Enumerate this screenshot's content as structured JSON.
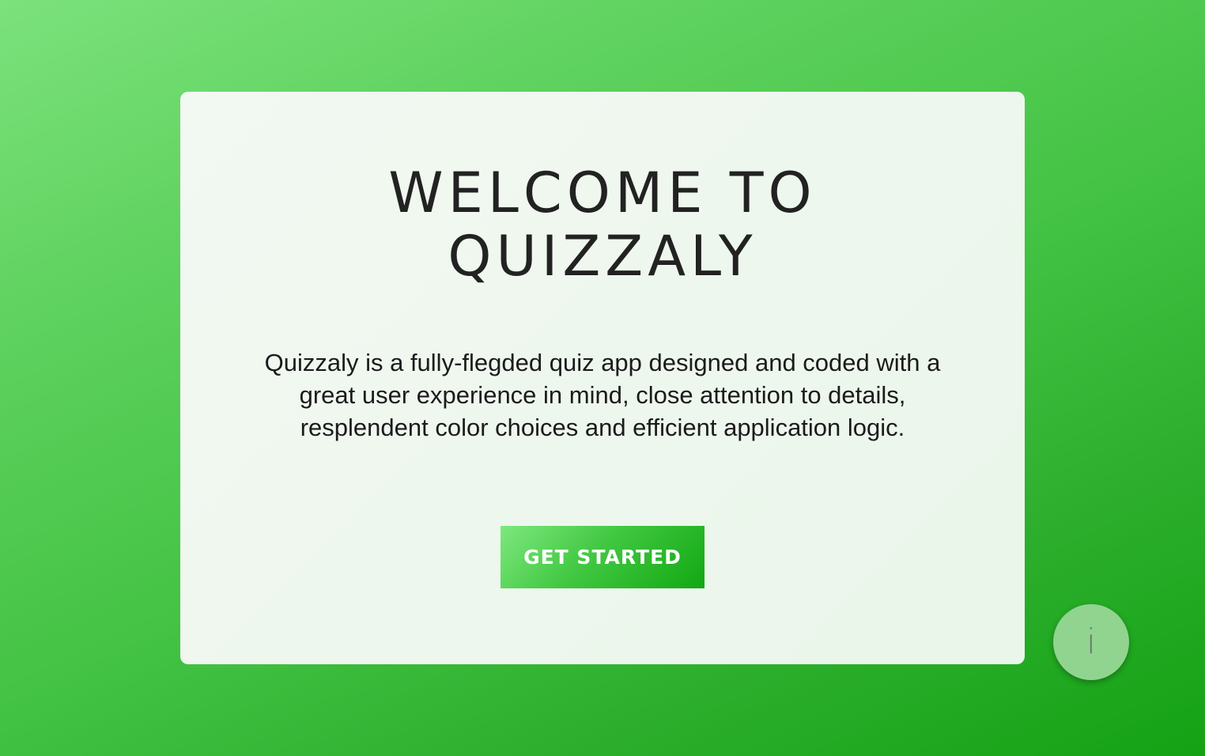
{
  "welcome": {
    "title_line1": "WELCOME TO",
    "title_line2": "QUIZZALY",
    "description": "Quizzaly is a fully-flegded quiz app designed and coded with a great user experience in mind, close attention to details, resplendent color choices and efficient application logic.",
    "cta_label": "GET STARTED"
  },
  "info_button": {
    "label": "i"
  },
  "colors": {
    "background_start": "#7ce27c",
    "background_end": "#14a214",
    "card_background": "#eef7ee",
    "button_start": "#7ee87e",
    "button_end": "#12a812",
    "info_button": "#90d490"
  }
}
